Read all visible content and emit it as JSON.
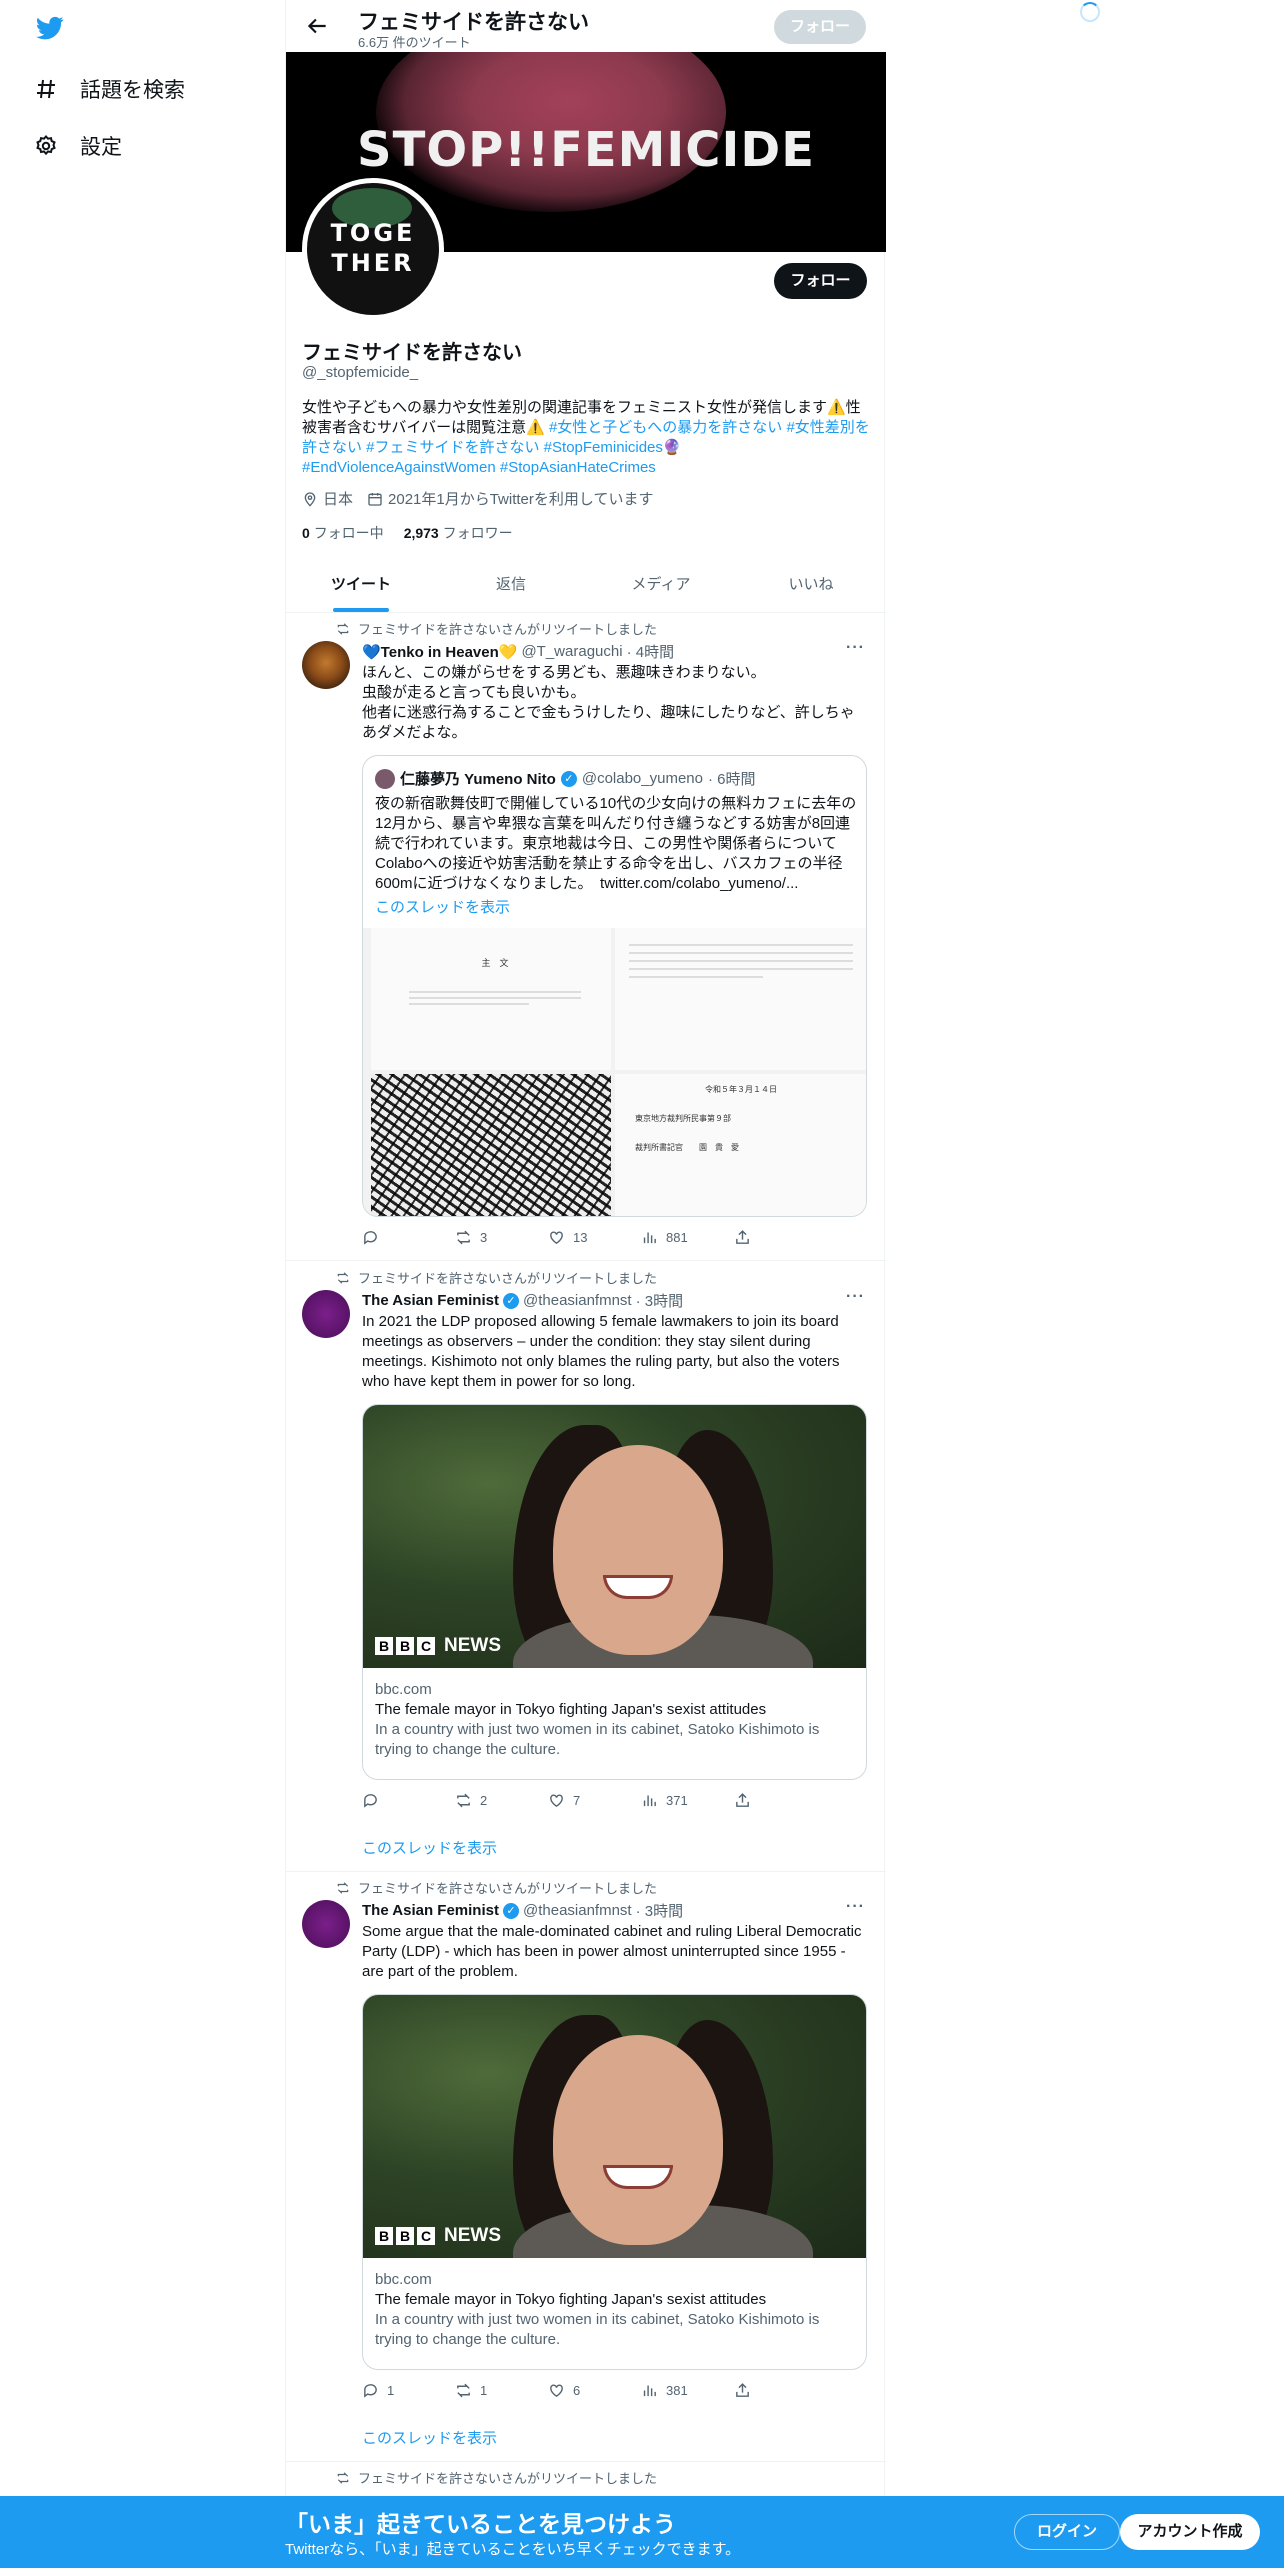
{
  "nav": {
    "explore_label": "話題を検索",
    "settings_label": "設定"
  },
  "topbar": {
    "title": "フェミサイドを許さない",
    "subtitle": "6.6万 件のツイート",
    "follow_label": "フォロー"
  },
  "banner": {
    "text": "STOP!!FEMICIDE",
    "avatar_line1": "TOGE",
    "avatar_line2": "THER"
  },
  "profile": {
    "follow_label": "フォロー",
    "name": "フェミサイドを許さない",
    "handle": "@_stopfemicide_",
    "bio_text": "女性や子どもへの暴力や女性差別の関連記事をフェミニスト女性が発信します⚠️性被害者含むサバイバーは閲覧注意⚠️ ",
    "bio_tags": "#女性と子どもへの暴力を許さない #女性差別を許さない #フェミサイドを許さない #StopFeminicides🔮 #EndViolenceAgainstWomen #StopAsianHateCrimes",
    "location": "日本",
    "joined": "2021年1月からTwitterを利用しています",
    "following_count": "0",
    "following_label": "フォロー中",
    "followers_count": "2,973",
    "followers_label": "フォロワー"
  },
  "tabs": [
    {
      "label": "ツイート"
    },
    {
      "label": "返信"
    },
    {
      "label": "メディア"
    },
    {
      "label": "いいね"
    }
  ],
  "tweets": [
    {
      "retweet_label": "フェミサイドを許さないさんがリツイートしました",
      "name": "💙Tenko in Heaven💛",
      "handle": "@T_waraguchi",
      "time": "· 4時間",
      "body": "ほんと、この嫌がらせをする男ども、悪趣味きわまりない。\n虫酸が走ると言っても良いかも。\n他者に迷惑行為することで金もうけしたり、趣味にしたりなど、許しちゃあダメだよな。",
      "quote": {
        "name": "仁藤夢乃 Yumeno Nito",
        "handle": "@colabo_yumeno",
        "time": "· 6時間",
        "body": "夜の新宿歌舞伎町で開催している10代の少女向けの無料カフェに去年の12月から、暴言や卑猥な言葉を叫んだり付き纏うなどする妨害が8回連続で行われています。東京地裁は今日、この男性や関係者らについてColaboへの接近や妨害活動を禁止する命令を出し、バスカフェの半径600mに近づけなくなりました。　twitter.com/colabo_yumeno/...",
        "thread_label": "このスレッドを表示",
        "doc_title": "主　文",
        "doc_date": "令和５年３月１４日",
        "doc_court": "東京地方裁判所民事第９部",
        "doc_judge": "裁判所書記官　　園　貴　愛"
      },
      "replies": "",
      "retweets": "3",
      "likes": "13",
      "views": "881"
    },
    {
      "retweet_label": "フェミサイドを許さないさんがリツイートしました",
      "name": "The Asian Feminist",
      "handle": "@theasianfmnst",
      "time": "· 3時間",
      "body": "In 2021 the LDP proposed allowing 5 female lawmakers to join its board meetings as observers – under the condition: they stay silent during meetings. Kishimoto not only blames the ruling party, but also the voters who have kept them in power for so long.",
      "card": {
        "domain": "bbc.com",
        "title": "The female mayor in Tokyo fighting Japan's sexist attitudes",
        "desc": "In a country with just two women in its cabinet, Satoko Kishimoto is trying to change the culture.",
        "brand": "NEWS"
      },
      "replies": "",
      "retweets": "2",
      "likes": "7",
      "views": "371",
      "thread_label": "このスレッドを表示"
    },
    {
      "retweet_label": "フェミサイドを許さないさんがリツイートしました",
      "name": "The Asian Feminist",
      "handle": "@theasianfmnst",
      "time": "· 3時間",
      "body": "Some argue that the male-dominated cabinet and ruling Liberal Democratic Party (LDP) - which has been in power almost uninterrupted since 1955 - are part of the problem.",
      "card": {
        "domain": "bbc.com",
        "title": "The female mayor in Tokyo fighting Japan's sexist attitudes",
        "desc": "In a country with just two women in its cabinet, Satoko Kishimoto is trying to change the culture.",
        "brand": "NEWS"
      },
      "replies": "1",
      "retweets": "1",
      "likes": "6",
      "views": "381",
      "thread_label": "このスレッドを表示"
    },
    {
      "retweet_label": "フェミサイドを許さないさんがリツイートしました"
    }
  ],
  "bottom": {
    "title": "「いま」起きていることを見つけよう",
    "subtitle": "Twitterなら、「いま」起きていることをいち早くチェックできます。",
    "login_label": "ログイン",
    "signup_label": "アカウント作成"
  },
  "colors": {
    "accent": "#1d9bf0",
    "text": "#0f1419",
    "muted": "#536471"
  }
}
